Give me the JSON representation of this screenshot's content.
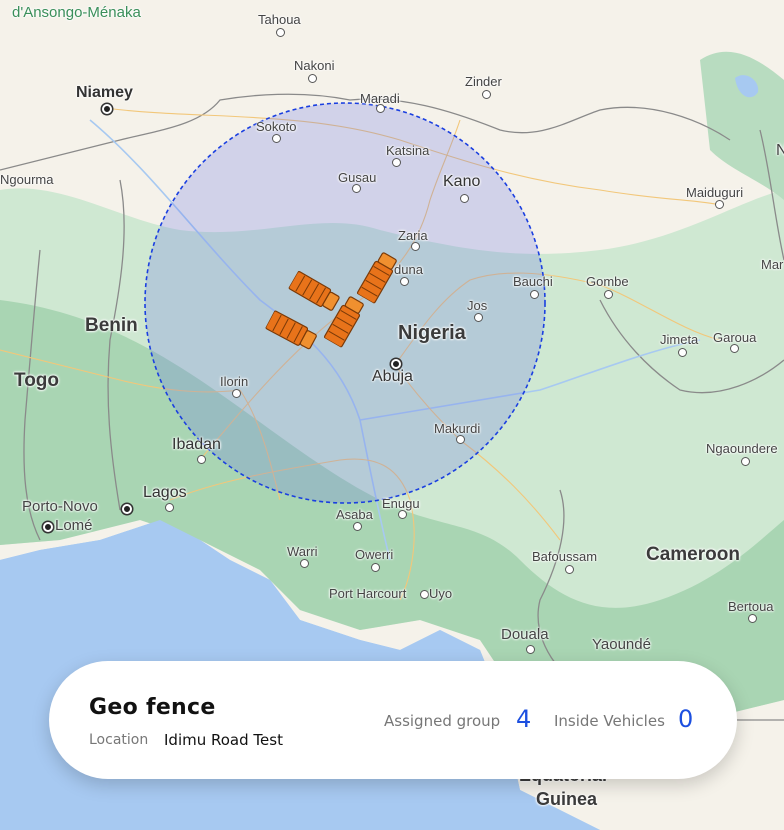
{
  "map": {
    "labels": {
      "ansongo": "d'Ansongo-Ménaka",
      "tahoua": "Tahoua",
      "nakoni": "Nakoni",
      "niamey": "Niamey",
      "zinder": "Zinder",
      "maradi": "Maradi",
      "sokoto": "Sokoto",
      "katsina": "Katsina",
      "gourma": "Ngourma",
      "gusau": "Gusau",
      "kano": "Kano",
      "maiduguri": "Maiduguri",
      "zaria": "Zaria",
      "kaduna": "duna",
      "bauchi": "Bauchi",
      "gombe": "Gombe",
      "benin": "Benin",
      "jos": "Jos",
      "nigeria": "Nigeria",
      "jimeta": "Jimeta",
      "garoua": "Garoua",
      "togo": "Togo",
      "ilorin": "Ilorin",
      "abuja": "Abuja",
      "makurdi": "Makurdi",
      "ibadan": "Ibadan",
      "ngaoundere": "Ngaoundere",
      "portonovo": "Porto-Novo",
      "lagos": "Lagos",
      "lome": "Lomé",
      "enugu": "Enugu",
      "asaba": "Asaba",
      "warri": "Warri",
      "owerri": "Owerri",
      "bafoussam": "Bafoussam",
      "cameroon": "Cameroon",
      "portharcourt": "Port Harcourt",
      "uyo": "Uyo",
      "bertoua": "Bertoua",
      "douala": "Douala",
      "yaounde": "Yaoundé",
      "mar": "Mar",
      "n": "N",
      "equatorial": "Equatorial",
      "guinea": "Guinea"
    },
    "geofence_color": "#1a3fe0",
    "vehicle_color": "#e8731a",
    "vehicle_count_shown": 4
  },
  "card": {
    "title": "Geo fence",
    "location_label": "Location",
    "location_value": "Idimu Road Test",
    "assigned_group_label": "Assigned group",
    "assigned_group_value": "4",
    "inside_vehicles_label": "Inside Vehicles",
    "inside_vehicles_value": "0"
  }
}
